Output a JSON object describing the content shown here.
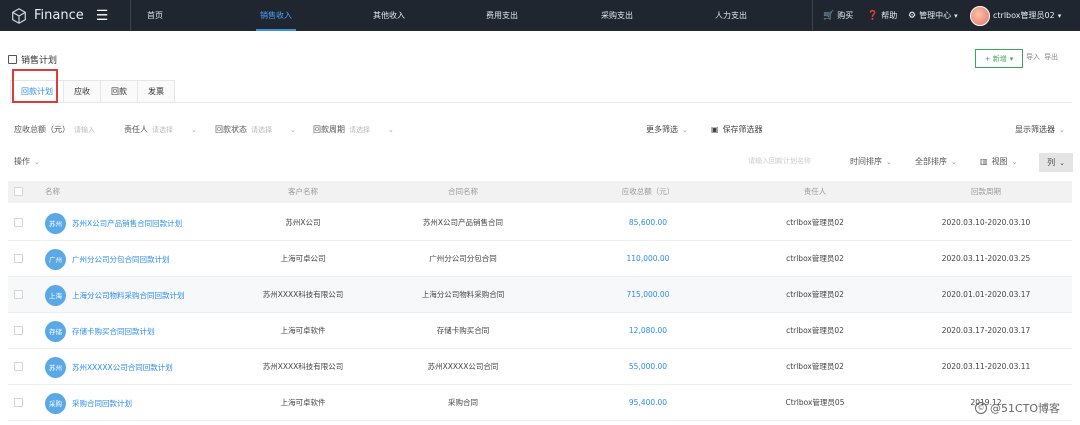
{
  "app": {
    "name": "Finance"
  },
  "nav": {
    "tabs": [
      "首页",
      "销售收入",
      "其他收入",
      "费用支出",
      "采购支出",
      "人力支出"
    ],
    "active": 1,
    "right": {
      "purchase": "购买",
      "help": "帮助",
      "manage": "管理中心",
      "user": "ctrlbox管理员02"
    }
  },
  "page": {
    "title": "销售计划",
    "new_button": "+ 新增",
    "import": "导入",
    "export": "导出"
  },
  "tabs": [
    "回款计划",
    "应收",
    "回款",
    "发票"
  ],
  "active_tab": 0,
  "filters": [
    {
      "label": "应收总额（元）",
      "placeholder": "请输入"
    },
    {
      "label": "责任人",
      "placeholder": "请选择"
    },
    {
      "label": "回款状态",
      "placeholder": "请选择"
    },
    {
      "label": "回款周期",
      "placeholder": "请选择"
    }
  ],
  "filter_actions": {
    "more": "更多筛选",
    "save": "保存筛选器",
    "show": "显示筛选器"
  },
  "toolbar": {
    "ops": "操作",
    "search_placeholder": "请输入回款计划名称",
    "time_sort": "时间排序",
    "all_sort": "全部排序",
    "view": "视图",
    "columns": "列"
  },
  "table": {
    "headers": [
      "名称",
      "客户名称",
      "合同名称",
      "应收总额（元）",
      "责任人",
      "回款周期"
    ],
    "rows": [
      {
        "badge": "苏州",
        "name": "苏州X公司产品销售合同回款计划",
        "customer": "苏州X公司",
        "contract": "苏州X公司产品销售合同",
        "amount": "85,600.00",
        "owner": "ctrlbox管理员02",
        "period": "2020.03.10-2020.03.10"
      },
      {
        "badge": "广州",
        "name": "广州分公司分包合同回款计划",
        "customer": "上海可卓公司",
        "contract": "广州分公司分包合同",
        "amount": "110,000.00",
        "owner": "ctrlbox管理员02",
        "period": "2020.03.11-2020.03.25"
      },
      {
        "badge": "上海",
        "name": "上海分公司物料采购合同回款计划",
        "customer": "苏州XXXX科技有限公司",
        "contract": "上海分公司物料采购合同",
        "amount": "715,000.00",
        "owner": "ctrlbox管理员02",
        "period": "2020.01.01-2020.03.17"
      },
      {
        "badge": "存储",
        "name": "存储卡购买合同回款计划",
        "customer": "上海可卓软件",
        "contract": "存储卡购买合同",
        "amount": "12,080.00",
        "owner": "ctrlbox管理员02",
        "period": "2020.03.17-2020.03.17"
      },
      {
        "badge": "苏州",
        "name": "苏州XXXXX公司合同回款计划",
        "customer": "苏州XXXX科技有限公司",
        "contract": "苏州XXXXX公司合同",
        "amount": "55,000.00",
        "owner": "ctrlbox管理员02",
        "period": "2020.03.11-2020.03.11"
      },
      {
        "badge": "采购",
        "name": "采购合同回款计划",
        "customer": "上海可卓软件",
        "contract": "采购合同",
        "amount": "95,400.00",
        "owner": "Ctrlbox管理员05",
        "period": "2019.12"
      }
    ]
  },
  "watermark": "@51CTO博客"
}
